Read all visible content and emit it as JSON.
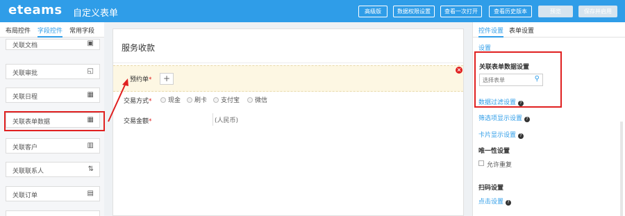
{
  "header": {
    "logo": "eteams",
    "title": "自定义表单",
    "buttons": [
      "高级版",
      "数据权限设置",
      "查看一次打开",
      "查看历史版本",
      "预览",
      "保存并启用"
    ]
  },
  "left_panel": {
    "tabs": [
      "布局控件",
      "字段控件",
      "常用字段"
    ],
    "widgets": [
      {
        "label": "关联文档",
        "icon": "▣"
      },
      {
        "label": "关联审批",
        "icon": "◱"
      },
      {
        "label": "关联日程",
        "icon": "▦"
      },
      {
        "label": "关联表单数据",
        "icon": "▦"
      },
      {
        "label": "关联客户",
        "icon": "▥"
      },
      {
        "label": "关联联系人",
        "icon": "⇅"
      },
      {
        "label": "关联订单",
        "icon": "▤"
      }
    ]
  },
  "canvas": {
    "title": "服务收款",
    "field1": {
      "label": "预约单",
      "required": "*",
      "add": "+"
    },
    "field2": {
      "label": "交易方式",
      "required": "*",
      "options": [
        "现金",
        "刷卡",
        "支付宝",
        "微信"
      ]
    },
    "field3": {
      "label": "交易金额",
      "required": "*",
      "unit": "(人民币)"
    },
    "delete": "×"
  },
  "right_panel": {
    "tabs": [
      "控件设置",
      "表单设置"
    ],
    "settings_link": "设置",
    "related_form_heading": "关联表单数据设置",
    "search_placeholder": "选择表单",
    "data_filter_link": "数据过滤设置",
    "display_link": "筛选项显示设置",
    "card_display_link": "卡片显示设置",
    "unique_heading": "唯一性设置",
    "unique_checkbox": "允许重复",
    "scan_heading": "扫码设置",
    "click_settings_link": "点击设置"
  }
}
